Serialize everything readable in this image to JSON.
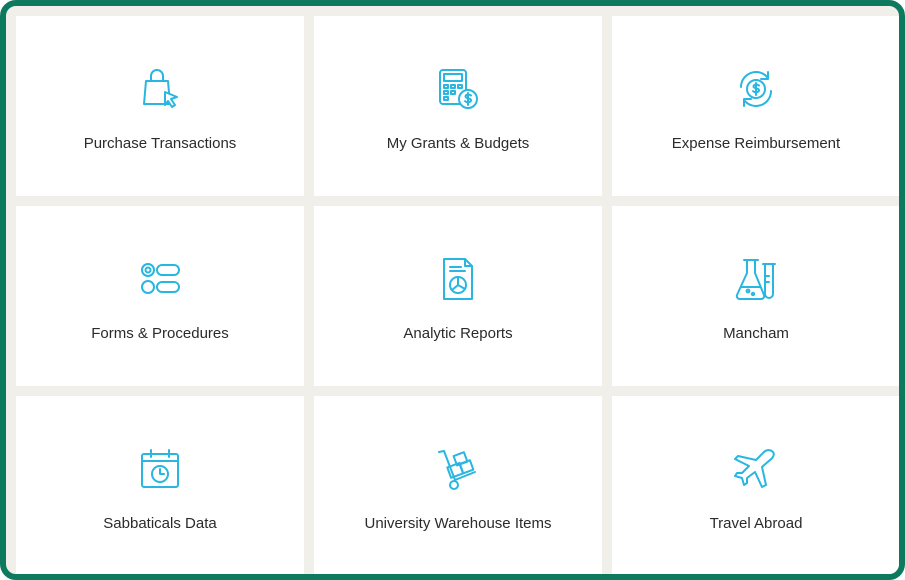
{
  "tiles": [
    {
      "label": "Purchase Transactions",
      "icon": "shopping-bag-cursor-icon"
    },
    {
      "label": "My Grants & Budgets",
      "icon": "calculator-dollar-icon"
    },
    {
      "label": "Expense Reimbursement",
      "icon": "refund-cycle-dollar-icon"
    },
    {
      "label": "Forms & Procedures",
      "icon": "form-options-icon"
    },
    {
      "label": "Analytic Reports",
      "icon": "report-chart-icon"
    },
    {
      "label": "Mancham",
      "icon": "lab-flask-icon"
    },
    {
      "label": "Sabbaticals Data",
      "icon": "calendar-clock-icon"
    },
    {
      "label": "University Warehouse Items",
      "icon": "hand-truck-boxes-icon"
    },
    {
      "label": "Travel Abroad",
      "icon": "airplane-icon"
    }
  ],
  "colors": {
    "frame_border": "#0d7a5f",
    "gutter": "#f1efe9",
    "tile_background": "#ffffff",
    "icon_accent": "#29b6e0",
    "label_text": "#2b2b2b"
  }
}
